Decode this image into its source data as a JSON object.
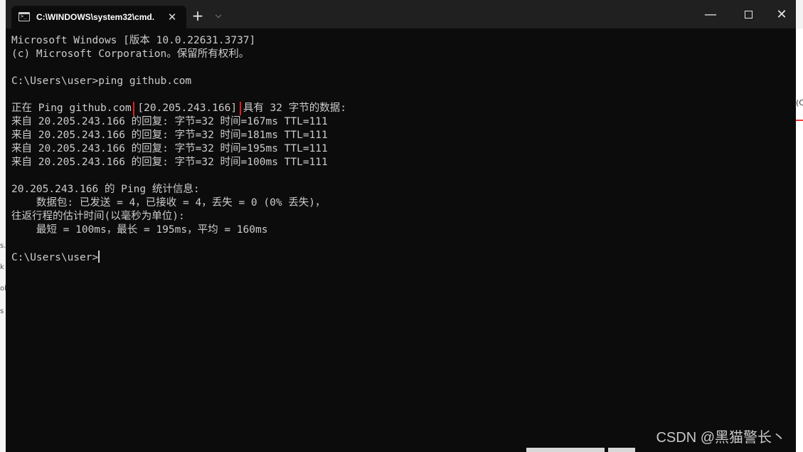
{
  "window": {
    "tab_title": "C:\\WINDOWS\\system32\\cmd.",
    "tab_close": "✕",
    "new_tab": "+",
    "dropdown": "⌵",
    "minimize": "—",
    "close": "✕"
  },
  "console": {
    "lines": [
      "Microsoft Windows [版本 10.0.22631.3737]",
      "(c) Microsoft Corporation。保留所有权利。",
      "",
      "C:\\Users\\user>ping github.com",
      "",
      "",
      "来自 20.205.243.166 的回复: 字节=32 时间=167ms TTL=111",
      "来自 20.205.243.166 的回复: 字节=32 时间=181ms TTL=111",
      "来自 20.205.243.166 的回复: 字节=32 时间=195ms TTL=111",
      "来自 20.205.243.166 的回复: 字节=32 时间=100ms TTL=111",
      "",
      "20.205.243.166 的 Ping 统计信息:",
      "    数据包: 已发送 = 4，已接收 = 4，丢失 = 0 (0% 丢失)，",
      "往返行程的估计时间(以毫秒为单位):",
      "    最短 = 100ms，最长 = 195ms，平均 = 160ms",
      "",
      "C:\\Users\\user>"
    ],
    "ping_line": {
      "prefix": "正在 Ping github.com ",
      "ip": "[20.205.243.166]",
      "suffix": " 具有 32 字节的数据:"
    }
  },
  "watermark": "CSDN @黑猫警长丶",
  "background_fragments": {
    "left": [
      "s.",
      "k",
      "ol",
      "s"
    ],
    "right": "(C"
  },
  "colors": {
    "terminal_bg": "#0c0c0c",
    "terminal_text": "#cccccc",
    "titlebar": "#202020",
    "highlight_box": "#e02020"
  }
}
